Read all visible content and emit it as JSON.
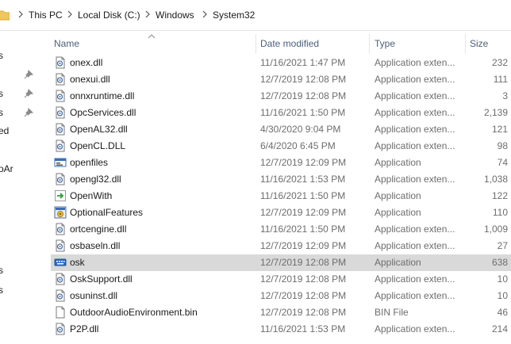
{
  "breadcrumb": [
    "This PC",
    "Local Disk (C:)",
    "Windows",
    "System32"
  ],
  "nav_fragments": [
    "s",
    "s",
    "s",
    "ed",
    "oAr",
    "s",
    "s"
  ],
  "columns": {
    "name": "Name",
    "date": "Date modified",
    "type": "Type",
    "size": "Size"
  },
  "files": [
    {
      "name": "onex.dll",
      "date": "11/16/2021 1:47 PM",
      "type": "Application exten...",
      "size": "232",
      "icon": "dll-file-icon"
    },
    {
      "name": "onexui.dll",
      "date": "12/7/2019 12:08 PM",
      "type": "Application exten...",
      "size": "111",
      "icon": "dll-file-icon"
    },
    {
      "name": "onnxruntime.dll",
      "date": "12/7/2019 12:08 PM",
      "type": "Application exten...",
      "size": "3",
      "icon": "dll-file-icon"
    },
    {
      "name": "OpcServices.dll",
      "date": "11/16/2021 1:50 PM",
      "type": "Application exten...",
      "size": "2,139",
      "icon": "dll-file-icon"
    },
    {
      "name": "OpenAL32.dll",
      "date": "4/30/2020 9:04 PM",
      "type": "Application exten...",
      "size": "121",
      "icon": "dll-file-icon"
    },
    {
      "name": "OpenCL.DLL",
      "date": "6/4/2020 6:45 PM",
      "type": "Application exten...",
      "size": "98",
      "icon": "dll-file-icon"
    },
    {
      "name": "openfiles",
      "date": "12/7/2019 12:09 PM",
      "type": "Application",
      "size": "74",
      "icon": "console-app-icon"
    },
    {
      "name": "opengl32.dll",
      "date": "11/16/2021 1:53 PM",
      "type": "Application exten...",
      "size": "1,038",
      "icon": "dll-file-icon"
    },
    {
      "name": "OpenWith",
      "date": "11/16/2021 1:50 PM",
      "type": "Application",
      "size": "122",
      "icon": "openwith-arrow-icon"
    },
    {
      "name": "OptionalFeatures",
      "date": "12/7/2019 12:09 PM",
      "type": "Application",
      "size": "110",
      "icon": "optional-features-icon"
    },
    {
      "name": "ortcengine.dll",
      "date": "11/16/2021 1:50 PM",
      "type": "Application exten...",
      "size": "1,009",
      "icon": "dll-file-icon"
    },
    {
      "name": "osbaseln.dll",
      "date": "12/7/2019 12:09 PM",
      "type": "Application exten...",
      "size": "27",
      "icon": "dll-file-icon"
    },
    {
      "name": "osk",
      "date": "12/7/2019 12:08 PM",
      "type": "Application",
      "size": "638",
      "icon": "keyboard-icon",
      "selected": true
    },
    {
      "name": "OskSupport.dll",
      "date": "12/7/2019 12:08 PM",
      "type": "Application exten...",
      "size": "10",
      "icon": "dll-file-icon"
    },
    {
      "name": "osuninst.dll",
      "date": "12/7/2019 12:08 PM",
      "type": "Application exten...",
      "size": "10",
      "icon": "dll-file-icon"
    },
    {
      "name": "OutdoorAudioEnvironment.bin",
      "date": "12/7/2019 12:08 PM",
      "type": "BIN File",
      "size": "46",
      "icon": "blank-file-icon"
    },
    {
      "name": "P2P.dll",
      "date": "11/16/2021 1:53 PM",
      "type": "Application exten...",
      "size": "214",
      "icon": "dll-file-icon"
    }
  ],
  "colors": {
    "selected_row": "#d9d9d9",
    "header_text": "#4c607a",
    "secondary_text": "#6d6d6d"
  }
}
